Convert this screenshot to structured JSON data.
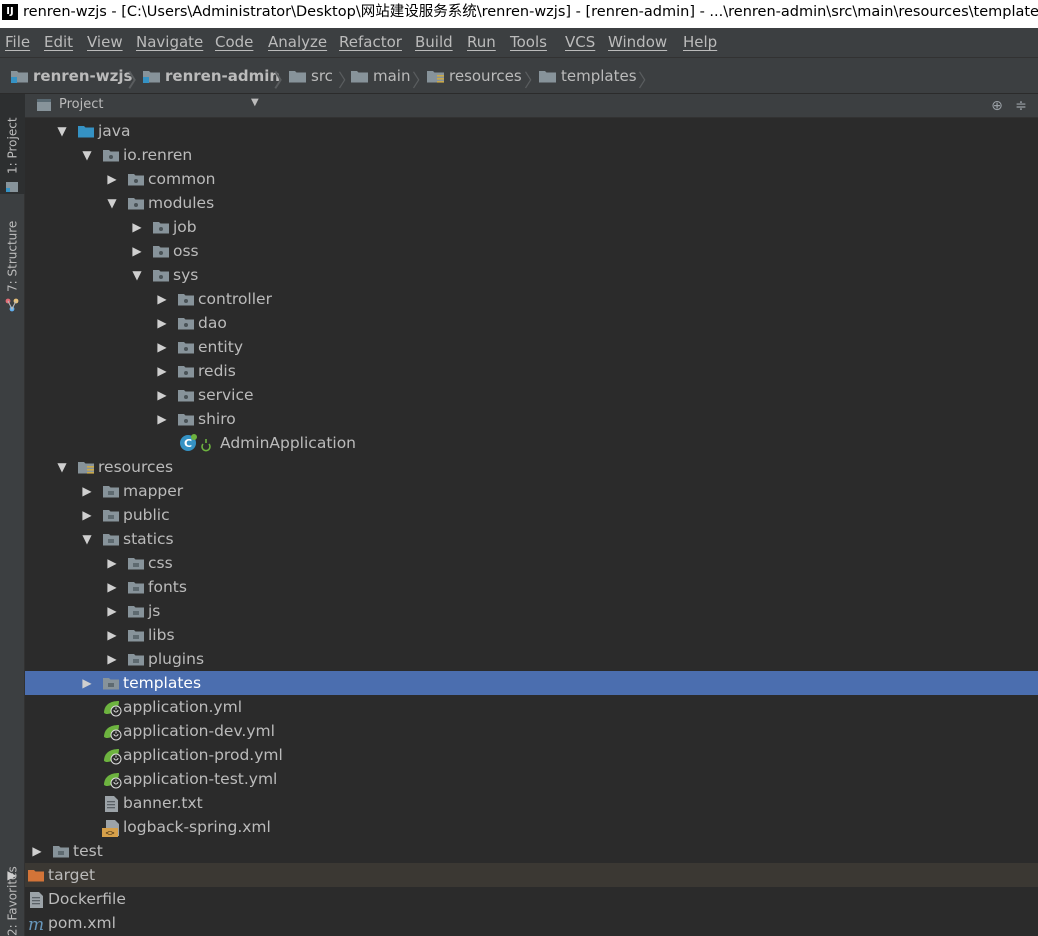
{
  "window": {
    "title": "renren-wzjs - [C:\\Users\\Administrator\\Desktop\\网站建设服务系统\\renren-wzjs] - [renren-admin] - ...\\renren-admin\\src\\main\\resources\\templates",
    "logo_text": "IJ"
  },
  "menu": {
    "items": [
      "File",
      "Edit",
      "View",
      "Navigate",
      "Code",
      "Analyze",
      "Refactor",
      "Build",
      "Run",
      "Tools",
      "VCS",
      "Window",
      "Help"
    ]
  },
  "breadcrumb": {
    "items": [
      "renren-wzjs",
      "renren-admin",
      "src",
      "main",
      "resources",
      "templates"
    ]
  },
  "toolstrip": {
    "project_tab": "1: Project",
    "structure_tab": "7: Structure",
    "favorites_tab": "2: Favorites"
  },
  "panel": {
    "title": "Project",
    "dropdown_glyph": "▼",
    "locate_glyph": "⊕",
    "collapse_glyph": "≑"
  },
  "tree": {
    "expanded_glyph": "▼",
    "collapsed_glyph": "▶",
    "rows": [
      {
        "label": "java",
        "icon": "source-folder-icon",
        "state": "expanded"
      },
      {
        "label": "io.renren",
        "icon": "package-icon",
        "state": "expanded"
      },
      {
        "label": "common",
        "icon": "package-icon",
        "state": "collapsed"
      },
      {
        "label": "modules",
        "icon": "package-icon",
        "state": "expanded"
      },
      {
        "label": "job",
        "icon": "package-icon",
        "state": "collapsed"
      },
      {
        "label": "oss",
        "icon": "package-icon",
        "state": "collapsed"
      },
      {
        "label": "sys",
        "icon": "package-icon",
        "state": "expanded"
      },
      {
        "label": "controller",
        "icon": "package-icon",
        "state": "collapsed"
      },
      {
        "label": "dao",
        "icon": "package-icon",
        "state": "collapsed"
      },
      {
        "label": "entity",
        "icon": "package-icon",
        "state": "collapsed"
      },
      {
        "label": "redis",
        "icon": "package-icon",
        "state": "collapsed"
      },
      {
        "label": "service",
        "icon": "package-icon",
        "state": "collapsed"
      },
      {
        "label": "shiro",
        "icon": "package-icon",
        "state": "collapsed"
      },
      {
        "label": "AdminApplication",
        "icon": "spring-boot-class-icon",
        "state": "leaf"
      },
      {
        "label": "resources",
        "icon": "resources-folder-icon",
        "state": "expanded"
      },
      {
        "label": "mapper",
        "icon": "folder-icon",
        "state": "collapsed"
      },
      {
        "label": "public",
        "icon": "folder-icon",
        "state": "collapsed"
      },
      {
        "label": "statics",
        "icon": "folder-icon",
        "state": "expanded"
      },
      {
        "label": "css",
        "icon": "folder-icon",
        "state": "collapsed"
      },
      {
        "label": "fonts",
        "icon": "folder-icon",
        "state": "collapsed"
      },
      {
        "label": "js",
        "icon": "folder-icon",
        "state": "collapsed"
      },
      {
        "label": "libs",
        "icon": "folder-icon",
        "state": "collapsed"
      },
      {
        "label": "plugins",
        "icon": "folder-icon",
        "state": "collapsed"
      },
      {
        "label": "templates",
        "icon": "folder-icon",
        "state": "collapsed",
        "selected": true
      },
      {
        "label": "application.yml",
        "icon": "spring-yml-icon",
        "state": "leaf"
      },
      {
        "label": "application-dev.yml",
        "icon": "spring-yml-icon",
        "state": "leaf"
      },
      {
        "label": "application-prod.yml",
        "icon": "spring-yml-icon",
        "state": "leaf"
      },
      {
        "label": "application-test.yml",
        "icon": "spring-yml-icon",
        "state": "leaf"
      },
      {
        "label": "banner.txt",
        "icon": "text-file-icon",
        "state": "leaf"
      },
      {
        "label": "logback-spring.xml",
        "icon": "xml-file-icon",
        "state": "leaf"
      },
      {
        "label": "test",
        "icon": "folder-icon",
        "state": "collapsed"
      },
      {
        "label": "target",
        "icon": "excluded-folder-icon",
        "state": "collapsed",
        "excluded": true
      },
      {
        "label": "Dockerfile",
        "icon": "text-file-icon",
        "state": "leaf"
      },
      {
        "label": "pom.xml",
        "icon": "maven-icon",
        "state": "leaf"
      }
    ]
  },
  "colors": {
    "selection": "#4b6eaf",
    "excluded_row": "#3b3833",
    "folder": "#87939a",
    "source_folder": "#3592c4",
    "excluded_folder": "#d37438",
    "spring_green": "#6db33f"
  }
}
